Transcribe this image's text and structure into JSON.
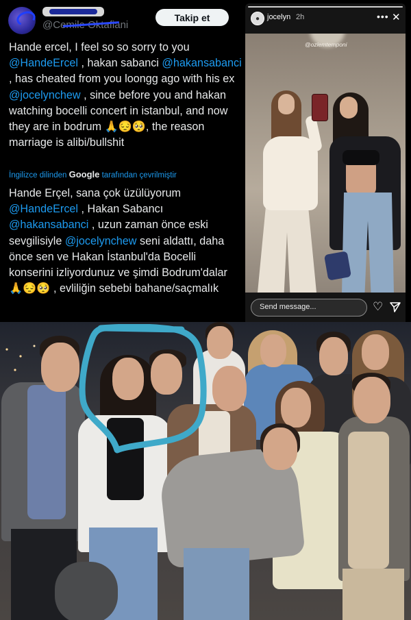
{
  "tweet": {
    "handle": "@Cemile Oktafiani",
    "follow_label": "Takip et",
    "body": [
      {
        "t": "Hande ercel, I feel so so sorry to you "
      },
      {
        "m": "@HandeErcel"
      },
      {
        "t": " , hakan sabanci "
      },
      {
        "m": "@hakansabanci"
      },
      {
        "t": " , has cheated from you loongg ago with his ex "
      },
      {
        "m": "@jocelynchew"
      },
      {
        "t": " , since before you and hakan watching bocelli concert in istanbul, and now they are in bodrum 🙏😔🥺, the reason marriage is alibi/bullshit"
      }
    ],
    "translation_note": {
      "before": "İngilizce dilinden ",
      "brand": "Google",
      "after": " tarafından çevrilmiştir"
    },
    "translated_body": [
      {
        "t": "Hande Erçel, sana çok üzülüyorum "
      },
      {
        "m": "@HandeErcel"
      },
      {
        "t": " , Hakan Sabancı "
      },
      {
        "m": "@hakansabanci"
      },
      {
        "t": " , uzun zaman önce eski sevgilisiyle "
      },
      {
        "m": "@jocelynchew"
      },
      {
        "t": " seni aldattı, daha önce sen ve Hakan İstanbul'da Bocelli konserini izliyordunuz ve şimdi Bodrum'dalar 🙏😔🥺 , evliliğin sebebi bahane/saçmalık"
      }
    ]
  },
  "story": {
    "username": "jocelyn",
    "time": "2h",
    "photo_tag": "@ozlemtemponi",
    "message_placeholder": "Send message...",
    "icons": {
      "more": "more-dots-icon",
      "close": "close-icon",
      "like": "heart-icon",
      "send": "send-icon"
    }
  },
  "group_photo": {
    "annotation_color": "#3fa9c9"
  }
}
